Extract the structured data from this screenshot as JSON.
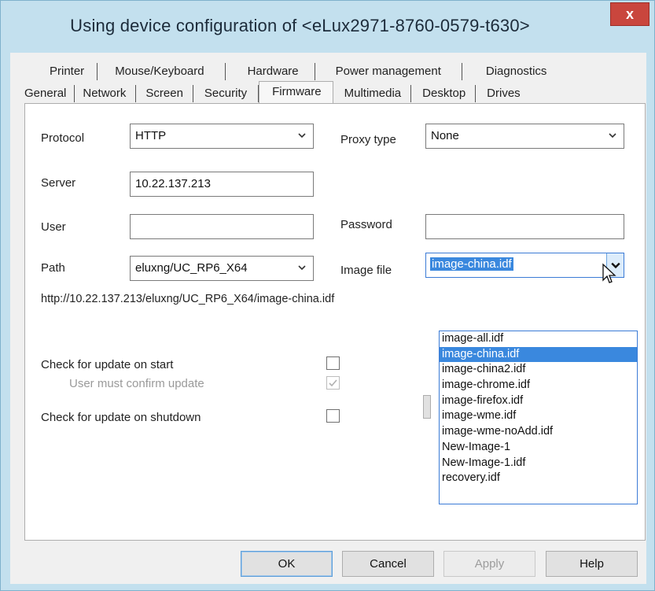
{
  "window": {
    "title": "Using device configuration of <eLux2971-8760-0579-t630>",
    "close_label": "x"
  },
  "tabs": {
    "back_row": [
      "Printer",
      "Mouse/Keyboard",
      "Hardware",
      "Power management",
      "Diagnostics"
    ],
    "front_row": [
      "General",
      "Network",
      "Screen",
      "Security",
      "Firmware",
      "Multimedia",
      "Desktop",
      "Drives"
    ],
    "active": "Firmware"
  },
  "firmware": {
    "protocol_label": "Protocol",
    "protocol_value": "HTTP",
    "proxy_type_label": "Proxy type",
    "proxy_type_value": "None",
    "server_label": "Server",
    "server_value": "10.22.137.213",
    "user_label": "User",
    "user_value": "",
    "password_label": "Password",
    "password_value": "",
    "path_label": "Path",
    "path_value": "eluxng/UC_RP6_X64",
    "image_file_label": "Image file",
    "image_file_value": "image-china.idf",
    "url_text": "http://10.22.137.213/eluxng/UC_RP6_X64/image-china.idf",
    "check_start_label": "Check for update on start",
    "check_start_checked": false,
    "confirm_label": "User must confirm update",
    "confirm_checked": true,
    "check_shutdown_label": "Check for update on shutdown",
    "check_shutdown_checked": false
  },
  "image_file_options": [
    "image-all.idf",
    "image-china.idf",
    "image-china2.idf",
    "image-chrome.idf",
    "image-firefox.idf",
    "image-wme.idf",
    "image-wme-noAdd.idf",
    "New-Image-1",
    "New-Image-1.idf",
    "recovery.idf"
  ],
  "buttons": {
    "ok": "OK",
    "cancel": "Cancel",
    "apply": "Apply",
    "help": "Help"
  },
  "colors": {
    "title_bar": "#c3e0ee",
    "close_button": "#c9463d",
    "selection": "#3a88de"
  }
}
